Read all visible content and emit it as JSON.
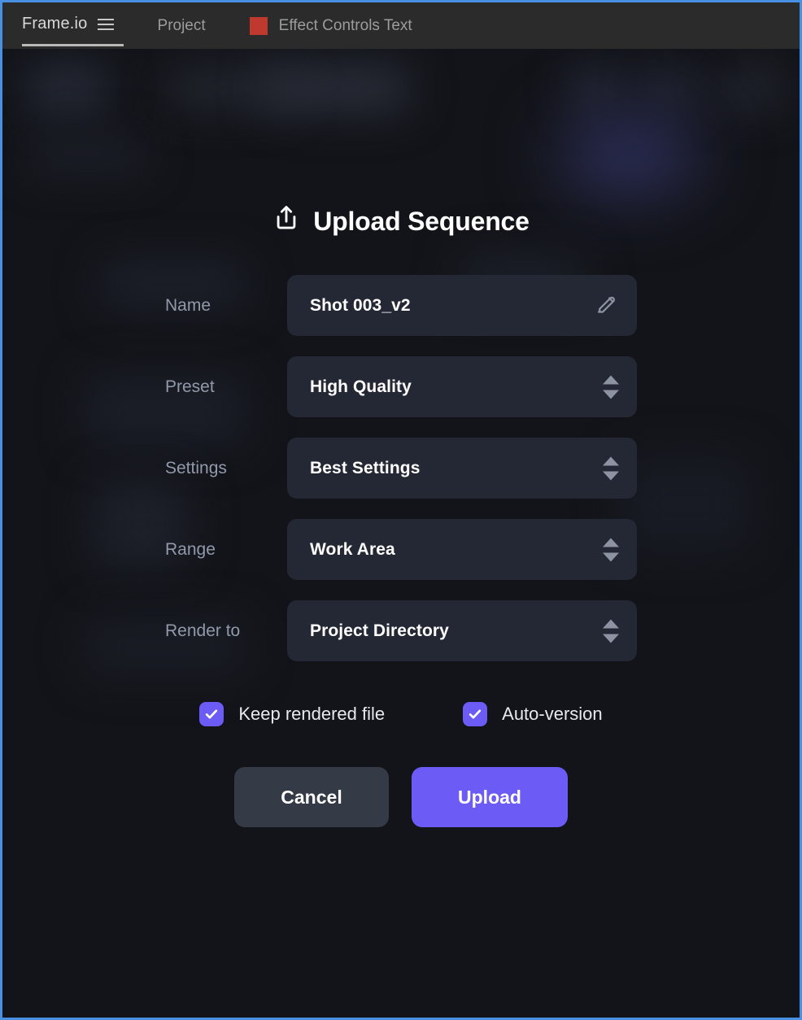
{
  "window": {
    "focus_border_color": "#4a90e2",
    "background_color": "#121419"
  },
  "topbar": {
    "brand": "Frame.io",
    "menu_icon": "hamburger-menu-icon",
    "project_label": "Project",
    "swatch_color": "#c0392f",
    "effect_label": "Effect Controls Text"
  },
  "dialog": {
    "icon": "upload-share-icon",
    "title": "Upload Sequence",
    "fields": [
      {
        "label": "Name",
        "value": "Shot 003_v2",
        "control": "text",
        "icon": "pencil-edit-icon"
      },
      {
        "label": "Preset",
        "value": "High Quality",
        "control": "stepper",
        "icon": "stepper-arrows-icon"
      },
      {
        "label": "Settings",
        "value": "Best Settings",
        "control": "stepper",
        "icon": "stepper-arrows-icon"
      },
      {
        "label": "Range",
        "value": "Work Area",
        "control": "stepper",
        "icon": "stepper-arrows-icon"
      },
      {
        "label": "Render to",
        "value": "Project Directory",
        "control": "stepper",
        "icon": "stepper-arrows-icon"
      }
    ],
    "checkboxes": [
      {
        "label": "Keep rendered file",
        "checked": "true"
      },
      {
        "label": "Auto-version",
        "checked": "true"
      }
    ],
    "cancel_label": "Cancel",
    "upload_label": "Upload",
    "accent_color": "#6c5cf5",
    "field_background": "#242834",
    "cancel_background": "#353a47"
  }
}
